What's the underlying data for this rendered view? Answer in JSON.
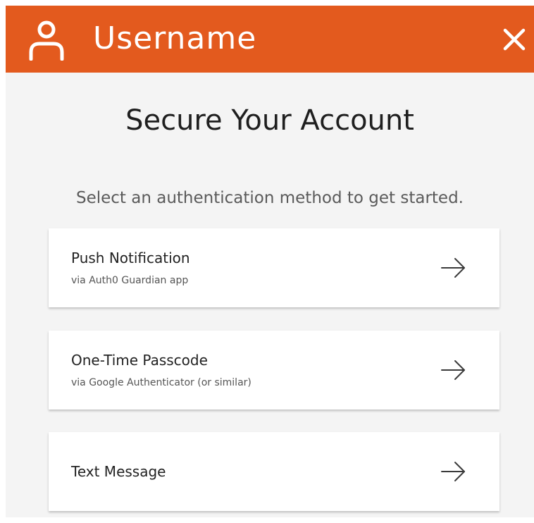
{
  "header": {
    "username": "Username",
    "user_icon": "user-icon",
    "close_icon": "close-icon",
    "accent_color": "#e35a1e"
  },
  "main": {
    "title": "Secure Your Account",
    "subtitle": "Select an authentication method to get started."
  },
  "options": [
    {
      "title": "Push Notification",
      "subtitle": "via Auth0 Guardian app",
      "icon": "arrow-right-icon"
    },
    {
      "title": "One-Time Passcode",
      "subtitle": "via Google Authenticator (or similar)",
      "icon": "arrow-right-icon"
    },
    {
      "title": "Text Message",
      "icon": "arrow-right-icon"
    }
  ]
}
